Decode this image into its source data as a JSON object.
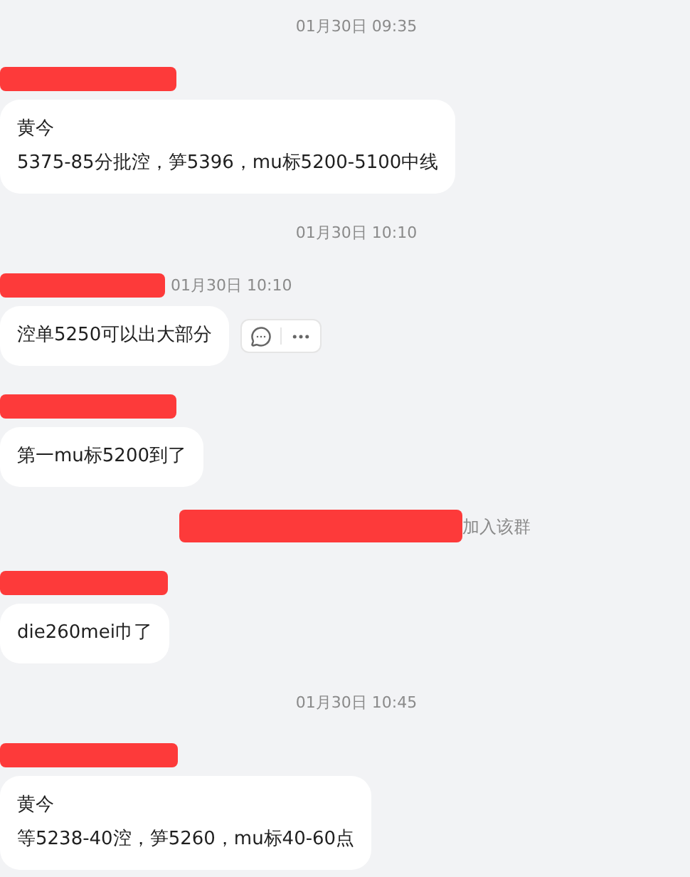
{
  "messages": [
    {
      "kind": "time",
      "text": "01月30日 09:35"
    },
    {
      "kind": "message",
      "lines": [
        "黄今",
        "5375-85分批涳，笋5396，mu标5200-5100中线"
      ],
      "actions_shown": false
    },
    {
      "kind": "time",
      "text": "01月30日 10:10"
    },
    {
      "kind": "message",
      "time": "01月30日 10:10",
      "lines": [
        "涳单5250可以出大部分"
      ],
      "actions_shown": true
    },
    {
      "kind": "message",
      "lines": [
        "第一mu标5200到了"
      ],
      "actions_shown": false
    },
    {
      "kind": "system",
      "text": "加入该群"
    },
    {
      "kind": "message",
      "lines": [
        "die260mei巾了"
      ],
      "actions_shown": false
    },
    {
      "kind": "time",
      "text": "01月30日 10:45"
    },
    {
      "kind": "message",
      "lines": [
        "黄今",
        "等5238-40涳，笋5260，mu标40-60点"
      ],
      "actions_shown": false
    }
  ]
}
